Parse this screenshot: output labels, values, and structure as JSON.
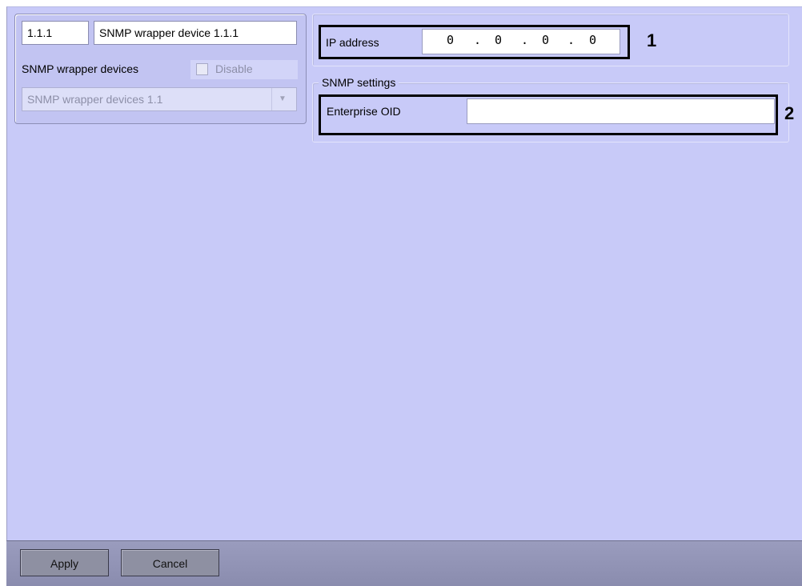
{
  "object_panel": {
    "id_value": "1.1.1",
    "name_value": "SNMP wrapper device 1.1.1",
    "parent_type_label": "SNMP wrapper devices",
    "disable_label": "Disable",
    "disable_checked": false,
    "parent_select_value": "SNMP wrapper devices 1.1"
  },
  "connection": {
    "ip_label": "IP address",
    "ip_octets": [
      "0",
      "0",
      "0",
      "0"
    ],
    "ip_separator": "."
  },
  "snmp_settings": {
    "legend": "SNMP settings",
    "oid_label": "Enterprise OID",
    "oid_value": ""
  },
  "callouts": {
    "ip": "1",
    "oid": "2"
  },
  "buttons": {
    "apply": "Apply",
    "cancel": "Cancel"
  }
}
